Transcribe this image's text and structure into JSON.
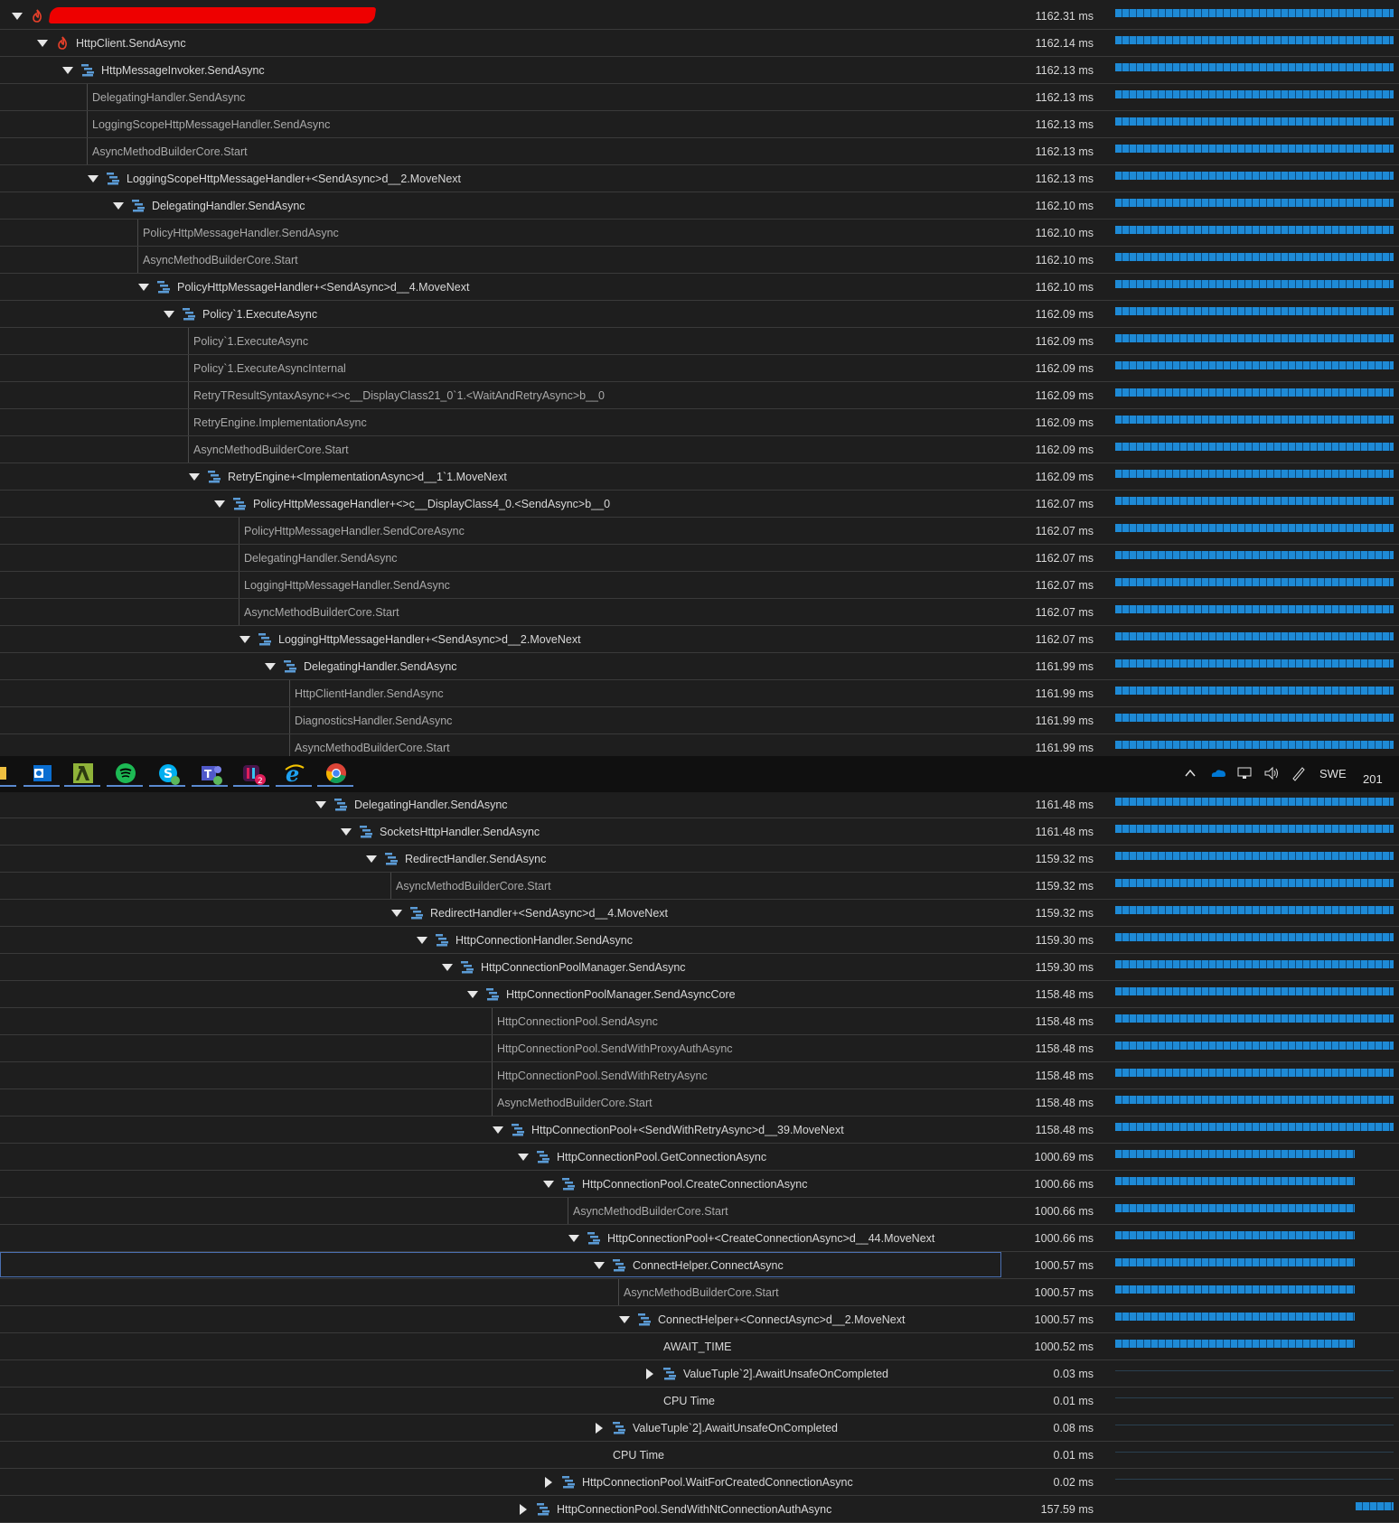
{
  "tree_top": [
    {
      "d": 0,
      "exp": true,
      "icon": "flame",
      "name": "",
      "redacted": true,
      "time": "1162.31 ms",
      "bar": 1.0
    },
    {
      "d": 1,
      "exp": true,
      "icon": "flame",
      "name": "HttpClient.SendAsync",
      "time": "1162.14 ms",
      "bar": 1.0
    },
    {
      "d": 2,
      "exp": true,
      "icon": "method",
      "name": "HttpMessageInvoker.SendAsync",
      "time": "1162.13 ms",
      "bar": 1.0
    },
    {
      "d": 3,
      "leaf": true,
      "name": "DelegatingHandler.SendAsync",
      "time": "1162.13 ms",
      "bar": 1.0
    },
    {
      "d": 3,
      "leaf": true,
      "name": "LoggingScopeHttpMessageHandler.SendAsync",
      "time": "1162.13 ms",
      "bar": 1.0
    },
    {
      "d": 3,
      "leaf": true,
      "name": "AsyncMethodBuilderCore.Start",
      "time": "1162.13 ms",
      "bar": 1.0
    },
    {
      "d": 3,
      "exp": true,
      "icon": "method",
      "name": "LoggingScopeHttpMessageHandler+<SendAsync>d__2.MoveNext",
      "time": "1162.13 ms",
      "bar": 1.0
    },
    {
      "d": 4,
      "exp": true,
      "icon": "method",
      "name": "DelegatingHandler.SendAsync",
      "time": "1162.10 ms",
      "bar": 1.0
    },
    {
      "d": 5,
      "leaf": true,
      "name": "PolicyHttpMessageHandler.SendAsync",
      "time": "1162.10 ms",
      "bar": 1.0
    },
    {
      "d": 5,
      "leaf": true,
      "name": "AsyncMethodBuilderCore.Start",
      "time": "1162.10 ms",
      "bar": 1.0
    },
    {
      "d": 5,
      "exp": true,
      "icon": "method",
      "name": "PolicyHttpMessageHandler+<SendAsync>d__4.MoveNext",
      "time": "1162.10 ms",
      "bar": 1.0
    },
    {
      "d": 6,
      "exp": true,
      "icon": "method",
      "name": "Policy`1.ExecuteAsync",
      "time": "1162.09 ms",
      "bar": 1.0
    },
    {
      "d": 7,
      "leaf": true,
      "name": "Policy`1.ExecuteAsync",
      "time": "1162.09 ms",
      "bar": 1.0
    },
    {
      "d": 7,
      "leaf": true,
      "name": "Policy`1.ExecuteAsyncInternal",
      "time": "1162.09 ms",
      "bar": 1.0
    },
    {
      "d": 7,
      "leaf": true,
      "name": "RetryTResultSyntaxAsync+<>c__DisplayClass21_0`1.<WaitAndRetryAsync>b__0",
      "time": "1162.09 ms",
      "bar": 1.0
    },
    {
      "d": 7,
      "leaf": true,
      "name": "RetryEngine.ImplementationAsync",
      "time": "1162.09 ms",
      "bar": 1.0
    },
    {
      "d": 7,
      "leaf": true,
      "name": "AsyncMethodBuilderCore.Start",
      "time": "1162.09 ms",
      "bar": 1.0
    },
    {
      "d": 7,
      "exp": true,
      "icon": "method",
      "name": "RetryEngine+<ImplementationAsync>d__1`1.MoveNext",
      "time": "1162.09 ms",
      "bar": 1.0
    },
    {
      "d": 8,
      "exp": true,
      "icon": "method",
      "name": "PolicyHttpMessageHandler+<>c__DisplayClass4_0.<SendAsync>b__0",
      "time": "1162.07 ms",
      "bar": 1.0
    },
    {
      "d": 9,
      "leaf": true,
      "name": "PolicyHttpMessageHandler.SendCoreAsync",
      "time": "1162.07 ms",
      "bar": 1.0
    },
    {
      "d": 9,
      "leaf": true,
      "name": "DelegatingHandler.SendAsync",
      "time": "1162.07 ms",
      "bar": 1.0
    },
    {
      "d": 9,
      "leaf": true,
      "name": "LoggingHttpMessageHandler.SendAsync",
      "time": "1162.07 ms",
      "bar": 1.0
    },
    {
      "d": 9,
      "leaf": true,
      "name": "AsyncMethodBuilderCore.Start",
      "time": "1162.07 ms",
      "bar": 1.0
    },
    {
      "d": 9,
      "exp": true,
      "icon": "method",
      "name": "LoggingHttpMessageHandler+<SendAsync>d__2.MoveNext",
      "time": "1162.07 ms",
      "bar": 1.0
    },
    {
      "d": 10,
      "exp": true,
      "icon": "method",
      "name": "DelegatingHandler.SendAsync",
      "time": "1161.99 ms",
      "bar": 1.0
    },
    {
      "d": 11,
      "leaf": true,
      "name": "HttpClientHandler.SendAsync",
      "time": "1161.99 ms",
      "bar": 1.0
    },
    {
      "d": 11,
      "leaf": true,
      "name": "DiagnosticsHandler.SendAsync",
      "time": "1161.99 ms",
      "bar": 1.0
    },
    {
      "d": 11,
      "leaf": true,
      "name": "AsyncMethodBuilderCore.Start",
      "time": "1161.99 ms",
      "bar": 1.0
    }
  ],
  "tree_bottom": [
    {
      "d": 12,
      "exp": true,
      "icon": "method",
      "name": "DelegatingHandler.SendAsync",
      "time": "1161.48 ms",
      "bar": 1.0
    },
    {
      "d": 13,
      "exp": true,
      "icon": "method",
      "name": "SocketsHttpHandler.SendAsync",
      "time": "1161.48 ms",
      "bar": 1.0
    },
    {
      "d": 14,
      "exp": true,
      "icon": "method",
      "name": "RedirectHandler.SendAsync",
      "time": "1159.32 ms",
      "bar": 1.0
    },
    {
      "d": 15,
      "leaf": true,
      "name": "AsyncMethodBuilderCore.Start",
      "time": "1159.32 ms",
      "bar": 1.0
    },
    {
      "d": 15,
      "exp": true,
      "icon": "method",
      "name": "RedirectHandler+<SendAsync>d__4.MoveNext",
      "time": "1159.32 ms",
      "bar": 1.0
    },
    {
      "d": 16,
      "exp": true,
      "icon": "method",
      "name": "HttpConnectionHandler.SendAsync",
      "time": "1159.30 ms",
      "bar": 1.0
    },
    {
      "d": 17,
      "exp": true,
      "icon": "method",
      "name": "HttpConnectionPoolManager.SendAsync",
      "time": "1159.30 ms",
      "bar": 1.0
    },
    {
      "d": 18,
      "exp": true,
      "icon": "method",
      "name": "HttpConnectionPoolManager.SendAsyncCore",
      "time": "1158.48 ms",
      "bar": 1.0
    },
    {
      "d": 19,
      "leaf": true,
      "name": "HttpConnectionPool.SendAsync",
      "time": "1158.48 ms",
      "bar": 1.0
    },
    {
      "d": 19,
      "leaf": true,
      "name": "HttpConnectionPool.SendWithProxyAuthAsync",
      "time": "1158.48 ms",
      "bar": 1.0
    },
    {
      "d": 19,
      "leaf": true,
      "name": "HttpConnectionPool.SendWithRetryAsync",
      "time": "1158.48 ms",
      "bar": 1.0
    },
    {
      "d": 19,
      "leaf": true,
      "name": "AsyncMethodBuilderCore.Start",
      "time": "1158.48 ms",
      "bar": 1.0
    },
    {
      "d": 19,
      "exp": true,
      "icon": "method",
      "name": "HttpConnectionPool+<SendWithRetryAsync>d__39.MoveNext",
      "time": "1158.48 ms",
      "bar": 1.0
    },
    {
      "d": 20,
      "exp": true,
      "icon": "method",
      "name": "HttpConnectionPool.GetConnectionAsync",
      "time": "1000.69 ms",
      "bar": 0.861
    },
    {
      "d": 21,
      "exp": true,
      "icon": "method",
      "name": "HttpConnectionPool.CreateConnectionAsync",
      "time": "1000.66 ms",
      "bar": 0.861
    },
    {
      "d": 22,
      "leaf": true,
      "name": "AsyncMethodBuilderCore.Start",
      "time": "1000.66 ms",
      "bar": 0.861
    },
    {
      "d": 22,
      "exp": true,
      "icon": "method",
      "name": "HttpConnectionPool+<CreateConnectionAsync>d__44.MoveNext",
      "time": "1000.66 ms",
      "bar": 0.861
    },
    {
      "d": 23,
      "exp": true,
      "icon": "method",
      "name": "ConnectHelper.ConnectAsync",
      "time": "1000.57 ms",
      "bar": 0.861,
      "selected": true
    },
    {
      "d": 24,
      "leaf": true,
      "name": "AsyncMethodBuilderCore.Start",
      "time": "1000.57 ms",
      "bar": 0.861
    },
    {
      "d": 24,
      "exp": true,
      "icon": "method",
      "name": "ConnectHelper+<ConnectAsync>d__2.MoveNext",
      "time": "1000.57 ms",
      "bar": 0.861
    },
    {
      "d": 25,
      "plain": true,
      "name": "AWAIT_TIME",
      "time": "1000.52 ms",
      "bar": 0.861
    },
    {
      "d": 25,
      "col": true,
      "icon": "method",
      "name": "ValueTuple`2].AwaitUnsafeOnCompleted",
      "time": "0.03 ms",
      "bar": 0
    },
    {
      "d": 25,
      "plain": true,
      "name": "CPU Time",
      "time": "0.01 ms",
      "bar": 0
    },
    {
      "d": 23,
      "col": true,
      "icon": "method",
      "name": "ValueTuple`2].AwaitUnsafeOnCompleted",
      "time": "0.08 ms",
      "bar": 0
    },
    {
      "d": 23,
      "plain": true,
      "name": "CPU Time",
      "time": "0.01 ms",
      "bar": 0
    },
    {
      "d": 21,
      "col": true,
      "icon": "method",
      "name": "HttpConnectionPool.WaitForCreatedConnectionAsync",
      "time": "0.02 ms",
      "bar": 0
    },
    {
      "d": 20,
      "col": true,
      "icon": "method",
      "name": "HttpConnectionPool.SendWithNtConnectionAuthAsync",
      "time": "157.59 ms",
      "bar": 0.136
    }
  ],
  "taskbar": {
    "apps": [
      "outlook-icon",
      "lambda-icon",
      "spotify-icon",
      "skype-icon",
      "teams-icon",
      "slack-icon",
      "ie-icon",
      "chrome-icon"
    ],
    "slack_badge": "2",
    "language": "SWE",
    "clock_fragment": "201"
  },
  "colors": {
    "bar": "#1e8ad6",
    "flame": "#e8402a",
    "method_icon": "#5b9bd5",
    "background": "#1e1e1e"
  }
}
